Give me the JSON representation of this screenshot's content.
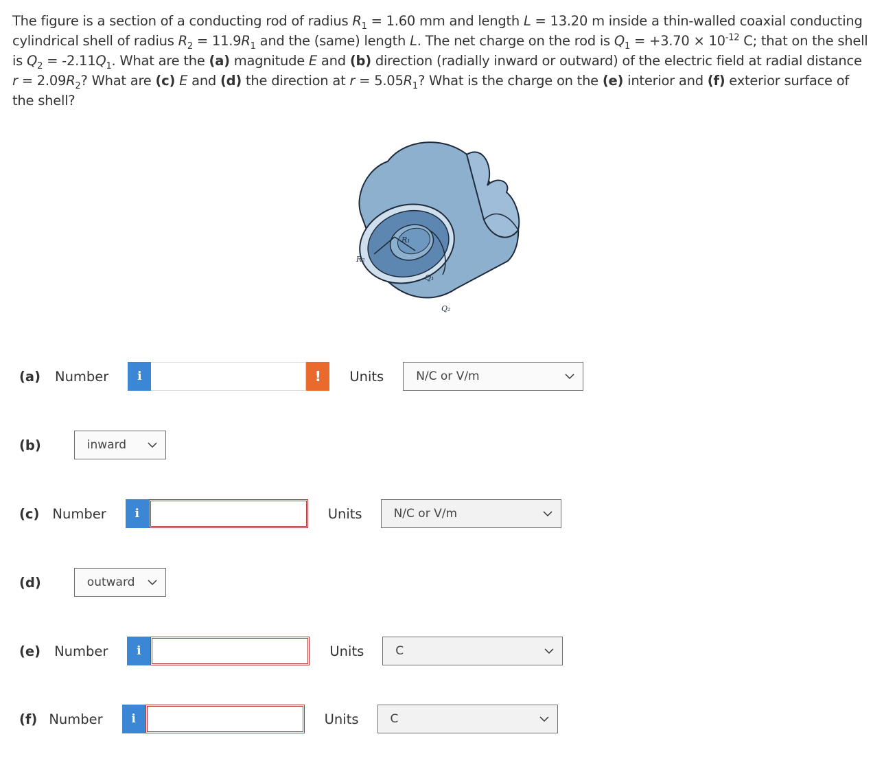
{
  "question": {
    "segments": [
      {
        "text": "The figure is a section of a conducting rod of radius "
      },
      {
        "text": "R",
        "style": "i"
      },
      {
        "text": "1",
        "style": "sub"
      },
      {
        "text": " = 1.60 mm and length "
      },
      {
        "text": "L",
        "style": "i"
      },
      {
        "text": " = 13.20 m inside a thin-walled coaxial conducting cylindrical shell of radius "
      },
      {
        "text": "R",
        "style": "i"
      },
      {
        "text": "2",
        "style": "sub"
      },
      {
        "text": " = 11.9"
      },
      {
        "text": "R",
        "style": "i"
      },
      {
        "text": "1",
        "style": "sub"
      },
      {
        "text": " and the (same) length "
      },
      {
        "text": "L",
        "style": "i"
      },
      {
        "text": ". The net charge on the rod is "
      },
      {
        "text": "Q",
        "style": "i"
      },
      {
        "text": "1",
        "style": "sub"
      },
      {
        "text": " = +3.70 × 10"
      },
      {
        "text": "-12",
        "style": "sup"
      },
      {
        "text": " C; that on the shell is "
      },
      {
        "text": "Q",
        "style": "i"
      },
      {
        "text": "2",
        "style": "sub"
      },
      {
        "text": " = -2.11"
      },
      {
        "text": "Q",
        "style": "i"
      },
      {
        "text": "1",
        "style": "sub"
      },
      {
        "text": ". What are the "
      },
      {
        "text": "(a)",
        "style": "b"
      },
      {
        "text": " magnitude "
      },
      {
        "text": "E",
        "style": "i"
      },
      {
        "text": " and "
      },
      {
        "text": "(b)",
        "style": "b"
      },
      {
        "text": " direction (radially inward or outward) of the electric field at radial distance "
      },
      {
        "text": "r",
        "style": "i"
      },
      {
        "text": " = 2.09"
      },
      {
        "text": "R",
        "style": "i"
      },
      {
        "text": "2",
        "style": "sub"
      },
      {
        "text": "? What are "
      },
      {
        "text": "(c)",
        "style": "b"
      },
      {
        "text": " "
      },
      {
        "text": "E",
        "style": "i"
      },
      {
        "text": " and "
      },
      {
        "text": "(d)",
        "style": "b"
      },
      {
        "text": " the direction at "
      },
      {
        "text": "r",
        "style": "i"
      },
      {
        "text": " = 5.05"
      },
      {
        "text": "R",
        "style": "i"
      },
      {
        "text": "1",
        "style": "sub"
      },
      {
        "text": "? What is the charge on the "
      },
      {
        "text": "(e)",
        "style": "b"
      },
      {
        "text": " interior and "
      },
      {
        "text": "(f)",
        "style": "b"
      },
      {
        "text": " exterior surface of the shell?"
      }
    ]
  },
  "figure": {
    "labels": {
      "r1": "R₁",
      "r2": "R₂",
      "q1": "Q₁",
      "q2": "Q₂"
    },
    "colors": {
      "shell": "#8eb0cf",
      "shell_dark": "#5d86b0",
      "outline": "#1e2b3a",
      "rim": "#cfdfee"
    }
  },
  "parts": {
    "a": {
      "label": "(a)",
      "number_label": "Number",
      "info": "i",
      "value": "",
      "alert": "!",
      "units_label": "Units",
      "units": "N/C or V/m"
    },
    "b": {
      "label": "(b)",
      "direction": "inward"
    },
    "c": {
      "label": "(c)",
      "number_label": "Number",
      "info": "i",
      "value": "",
      "units_label": "Units",
      "units": "N/C or V/m"
    },
    "d": {
      "label": "(d)",
      "direction": "outward"
    },
    "e": {
      "label": "(e)",
      "number_label": "Number",
      "info": "i",
      "value": "",
      "units_label": "Units",
      "units": "C"
    },
    "f": {
      "label": "(f)",
      "number_label": "Number",
      "info": "i",
      "value": "",
      "units_label": "Units",
      "units": "C"
    }
  },
  "colors": {
    "info_button": "#3b87d5",
    "alert_button": "#ea6a2e",
    "error_border": "#b03a3a"
  }
}
